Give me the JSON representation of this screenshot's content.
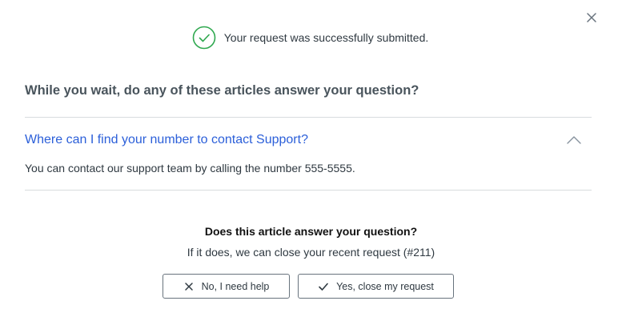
{
  "dialog": {
    "success_message": "Your request was successfully submitted.",
    "heading": "While you wait, do any of these articles answer your question?"
  },
  "article": {
    "title": "Where can I find your number to contact Support?",
    "body": "You can contact our support team by calling the number 555-5555."
  },
  "feedback": {
    "question": "Does this article answer your question?",
    "subtext": "If it does, we can close your recent request (#211)",
    "no_label": "No, I need help",
    "yes_label": "Yes, close my request"
  },
  "icons": {
    "close": "close-icon",
    "success": "check-circle-icon",
    "collapse": "chevron-up-icon",
    "no": "x-icon",
    "yes": "check-icon"
  },
  "colors": {
    "success_green": "#2fa84f",
    "link_blue": "#2b5fd9",
    "divider": "#d8dcde"
  }
}
